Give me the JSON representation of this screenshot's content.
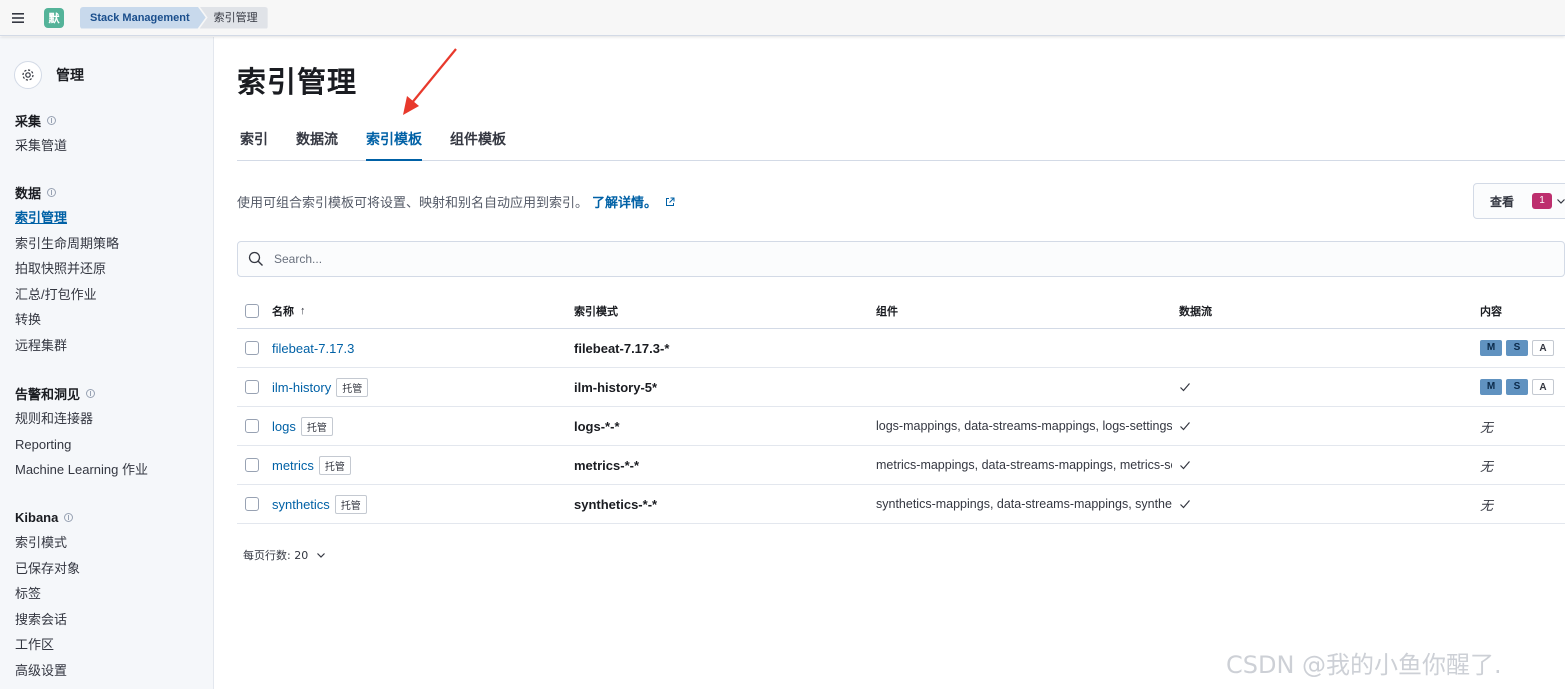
{
  "header": {
    "space_initial": "默",
    "breadcrumbs": [
      "Stack Management",
      "索引管理"
    ]
  },
  "sidebar": {
    "title": "管理",
    "groups": [
      {
        "title": "采集",
        "items": [
          "采集管道"
        ]
      },
      {
        "title": "数据",
        "items": [
          "索引管理",
          "索引生命周期策略",
          "拍取快照并还原",
          "汇总/打包作业",
          "转换",
          "远程集群"
        ]
      },
      {
        "title": "告警和洞见",
        "items": [
          "规则和连接器",
          "Reporting",
          "Machine Learning 作业"
        ]
      },
      {
        "title": "Kibana",
        "items": [
          "索引模式",
          "已保存对象",
          "标签",
          "搜索会话",
          "工作区",
          "高级设置"
        ]
      }
    ]
  },
  "main": {
    "title": "索引管理",
    "tabs": [
      "索引",
      "数据流",
      "索引模板",
      "组件模板"
    ],
    "active_tab": "索引模板",
    "description": "使用可组合索引模板可将设置、映射和别名自动应用到索引。",
    "description_link": "了解详情。",
    "view_button": {
      "label": "查看",
      "count": "1"
    },
    "search_placeholder": "Search...",
    "table": {
      "headers": {
        "name": "名称",
        "pattern": "索引模式",
        "components": "组件",
        "data_stream": "数据流",
        "content": "内容"
      },
      "rows": [
        {
          "name": "filebeat-7.17.3",
          "managed": "",
          "pattern": "filebeat-7.17.3-*",
          "components": "",
          "data_stream": false,
          "content": [
            "M",
            "S",
            "A"
          ]
        },
        {
          "name": "ilm-history",
          "managed": "托管",
          "pattern": "ilm-history-5*",
          "components": "",
          "data_stream": true,
          "content": [
            "M",
            "S",
            "A"
          ]
        },
        {
          "name": "logs",
          "managed": "托管",
          "pattern": "logs-*-*",
          "components": "logs-mappings, data-streams-mappings, logs-settings",
          "data_stream": true,
          "content_text": "无"
        },
        {
          "name": "metrics",
          "managed": "托管",
          "pattern": "metrics-*-*",
          "components": "metrics-mappings, data-streams-mappings, metrics-settings",
          "data_stream": true,
          "content_text": "无"
        },
        {
          "name": "synthetics",
          "managed": "托管",
          "pattern": "synthetics-*-*",
          "components": "synthetics-mappings, data-streams-mappings, synthetics-settings",
          "data_stream": true,
          "content_text": "无"
        }
      ]
    },
    "pager": "每页行数: 20"
  },
  "watermark": "CSDN @我的小鱼你醒了.",
  "colors": {
    "link": "#0061a6",
    "badge_pink": "#bd2f6e",
    "content_badge": "#6092c0",
    "annotation_arrow": "#e8392c"
  }
}
